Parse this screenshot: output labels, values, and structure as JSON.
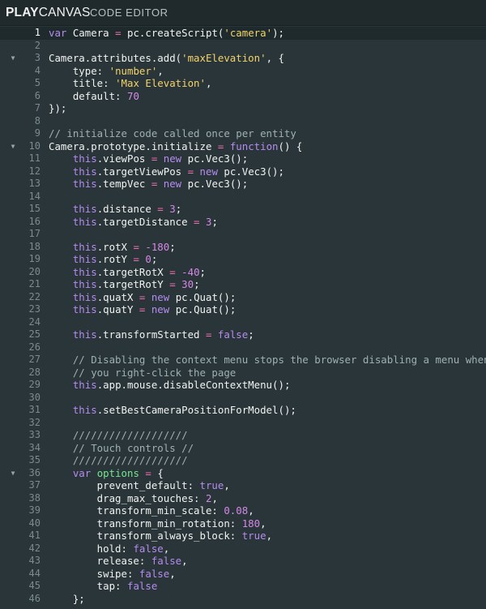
{
  "app": {
    "logo_play": "PLAY",
    "logo_canvas": "CANVAS",
    "subtitle": "CODE EDITOR"
  },
  "colors": {
    "background": "#293538",
    "keyword": "#b58cf0",
    "string": "#f3d36b",
    "number": "#d688e8",
    "comment": "#9fb0b3",
    "operator": "#ec6dac",
    "declaration": "#76e68f"
  },
  "editor": {
    "active_line": 1,
    "folded_lines": [
      3,
      10,
      36
    ],
    "fold_icon": "triangle-down-icon",
    "lines": [
      [
        [
          "kw",
          "var"
        ],
        [
          "p",
          " Camera "
        ],
        [
          "op",
          "="
        ],
        [
          "p",
          " pc.createScript("
        ],
        [
          "str",
          "'camera'"
        ],
        [
          "p",
          ");"
        ]
      ],
      [],
      [
        [
          "p",
          "Camera.attributes.add("
        ],
        [
          "str",
          "'maxElevation'"
        ],
        [
          "p",
          ", {"
        ]
      ],
      [
        [
          "p",
          "    type: "
        ],
        [
          "str",
          "'number'"
        ],
        [
          "p",
          ","
        ]
      ],
      [
        [
          "p",
          "    title: "
        ],
        [
          "str",
          "'Max Elevation'"
        ],
        [
          "p",
          ","
        ]
      ],
      [
        [
          "p",
          "    default: "
        ],
        [
          "num",
          "70"
        ]
      ],
      [
        [
          "p",
          "});"
        ]
      ],
      [],
      [
        [
          "com",
          "// initialize code called once per entity"
        ]
      ],
      [
        [
          "p",
          "Camera.prototype.initialize "
        ],
        [
          "op",
          "="
        ],
        [
          "p",
          " "
        ],
        [
          "kw",
          "function"
        ],
        [
          "p",
          "() {"
        ]
      ],
      [
        [
          "p",
          "    "
        ],
        [
          "kw",
          "this"
        ],
        [
          "p",
          ".viewPos "
        ],
        [
          "op",
          "="
        ],
        [
          "p",
          " "
        ],
        [
          "kw",
          "new"
        ],
        [
          "p",
          " pc.Vec3();"
        ]
      ],
      [
        [
          "p",
          "    "
        ],
        [
          "kw",
          "this"
        ],
        [
          "p",
          ".targetViewPos "
        ],
        [
          "op",
          "="
        ],
        [
          "p",
          " "
        ],
        [
          "kw",
          "new"
        ],
        [
          "p",
          " pc.Vec3();"
        ]
      ],
      [
        [
          "p",
          "    "
        ],
        [
          "kw",
          "this"
        ],
        [
          "p",
          ".tempVec "
        ],
        [
          "op",
          "="
        ],
        [
          "p",
          " "
        ],
        [
          "kw",
          "new"
        ],
        [
          "p",
          " pc.Vec3();"
        ]
      ],
      [],
      [
        [
          "p",
          "    "
        ],
        [
          "kw",
          "this"
        ],
        [
          "p",
          ".distance "
        ],
        [
          "op",
          "="
        ],
        [
          "p",
          " "
        ],
        [
          "num",
          "3"
        ],
        [
          "p",
          ";"
        ]
      ],
      [
        [
          "p",
          "    "
        ],
        [
          "kw",
          "this"
        ],
        [
          "p",
          ".targetDistance "
        ],
        [
          "op",
          "="
        ],
        [
          "p",
          " "
        ],
        [
          "num",
          "3"
        ],
        [
          "p",
          ";"
        ]
      ],
      [],
      [
        [
          "p",
          "    "
        ],
        [
          "kw",
          "this"
        ],
        [
          "p",
          ".rotX "
        ],
        [
          "op",
          "="
        ],
        [
          "p",
          " "
        ],
        [
          "num",
          "-180"
        ],
        [
          "p",
          ";"
        ]
      ],
      [
        [
          "p",
          "    "
        ],
        [
          "kw",
          "this"
        ],
        [
          "p",
          ".rotY "
        ],
        [
          "op",
          "="
        ],
        [
          "p",
          " "
        ],
        [
          "num",
          "0"
        ],
        [
          "p",
          ";"
        ]
      ],
      [
        [
          "p",
          "    "
        ],
        [
          "kw",
          "this"
        ],
        [
          "p",
          ".targetRotX "
        ],
        [
          "op",
          "="
        ],
        [
          "p",
          " "
        ],
        [
          "num",
          "-40"
        ],
        [
          "p",
          ";"
        ]
      ],
      [
        [
          "p",
          "    "
        ],
        [
          "kw",
          "this"
        ],
        [
          "p",
          ".targetRotY "
        ],
        [
          "op",
          "="
        ],
        [
          "p",
          " "
        ],
        [
          "num",
          "30"
        ],
        [
          "p",
          ";"
        ]
      ],
      [
        [
          "p",
          "    "
        ],
        [
          "kw",
          "this"
        ],
        [
          "p",
          ".quatX "
        ],
        [
          "op",
          "="
        ],
        [
          "p",
          " "
        ],
        [
          "kw",
          "new"
        ],
        [
          "p",
          " pc.Quat();"
        ]
      ],
      [
        [
          "p",
          "    "
        ],
        [
          "kw",
          "this"
        ],
        [
          "p",
          ".quatY "
        ],
        [
          "op",
          "="
        ],
        [
          "p",
          " "
        ],
        [
          "kw",
          "new"
        ],
        [
          "p",
          " pc.Quat();"
        ]
      ],
      [],
      [
        [
          "p",
          "    "
        ],
        [
          "kw",
          "this"
        ],
        [
          "p",
          ".transformStarted "
        ],
        [
          "op",
          "="
        ],
        [
          "p",
          " "
        ],
        [
          "kw",
          "false"
        ],
        [
          "p",
          ";"
        ]
      ],
      [],
      [
        [
          "com",
          "    // Disabling the context menu stops the browser disabling a menu when"
        ]
      ],
      [
        [
          "com",
          "    // you right-click the page"
        ]
      ],
      [
        [
          "p",
          "    "
        ],
        [
          "kw",
          "this"
        ],
        [
          "p",
          ".app.mouse.disableContextMenu();"
        ]
      ],
      [],
      [
        [
          "p",
          "    "
        ],
        [
          "kw",
          "this"
        ],
        [
          "p",
          ".setBestCameraPositionForModel();"
        ]
      ],
      [],
      [
        [
          "com",
          "    ///////////////////"
        ]
      ],
      [
        [
          "com",
          "    // Touch controls //"
        ]
      ],
      [
        [
          "com",
          "    ///////////////////"
        ]
      ],
      [
        [
          "p",
          "    "
        ],
        [
          "kw",
          "var"
        ],
        [
          "p",
          " "
        ],
        [
          "fn",
          "options"
        ],
        [
          "p",
          " "
        ],
        [
          "op",
          "="
        ],
        [
          "p",
          " {"
        ]
      ],
      [
        [
          "p",
          "        prevent_default: "
        ],
        [
          "kw",
          "true"
        ],
        [
          "p",
          ","
        ]
      ],
      [
        [
          "p",
          "        drag_max_touches: "
        ],
        [
          "num",
          "2"
        ],
        [
          "p",
          ","
        ]
      ],
      [
        [
          "p",
          "        transform_min_scale: "
        ],
        [
          "num",
          "0.08"
        ],
        [
          "p",
          ","
        ]
      ],
      [
        [
          "p",
          "        transform_min_rotation: "
        ],
        [
          "num",
          "180"
        ],
        [
          "p",
          ","
        ]
      ],
      [
        [
          "p",
          "        transform_always_block: "
        ],
        [
          "kw",
          "true"
        ],
        [
          "p",
          ","
        ]
      ],
      [
        [
          "p",
          "        hold: "
        ],
        [
          "kw",
          "false"
        ],
        [
          "p",
          ","
        ]
      ],
      [
        [
          "p",
          "        release: "
        ],
        [
          "kw",
          "false"
        ],
        [
          "p",
          ","
        ]
      ],
      [
        [
          "p",
          "        swipe: "
        ],
        [
          "kw",
          "false"
        ],
        [
          "p",
          ","
        ]
      ],
      [
        [
          "p",
          "        tap: "
        ],
        [
          "kw",
          "false"
        ]
      ],
      [
        [
          "p",
          "    };"
        ]
      ]
    ]
  }
}
